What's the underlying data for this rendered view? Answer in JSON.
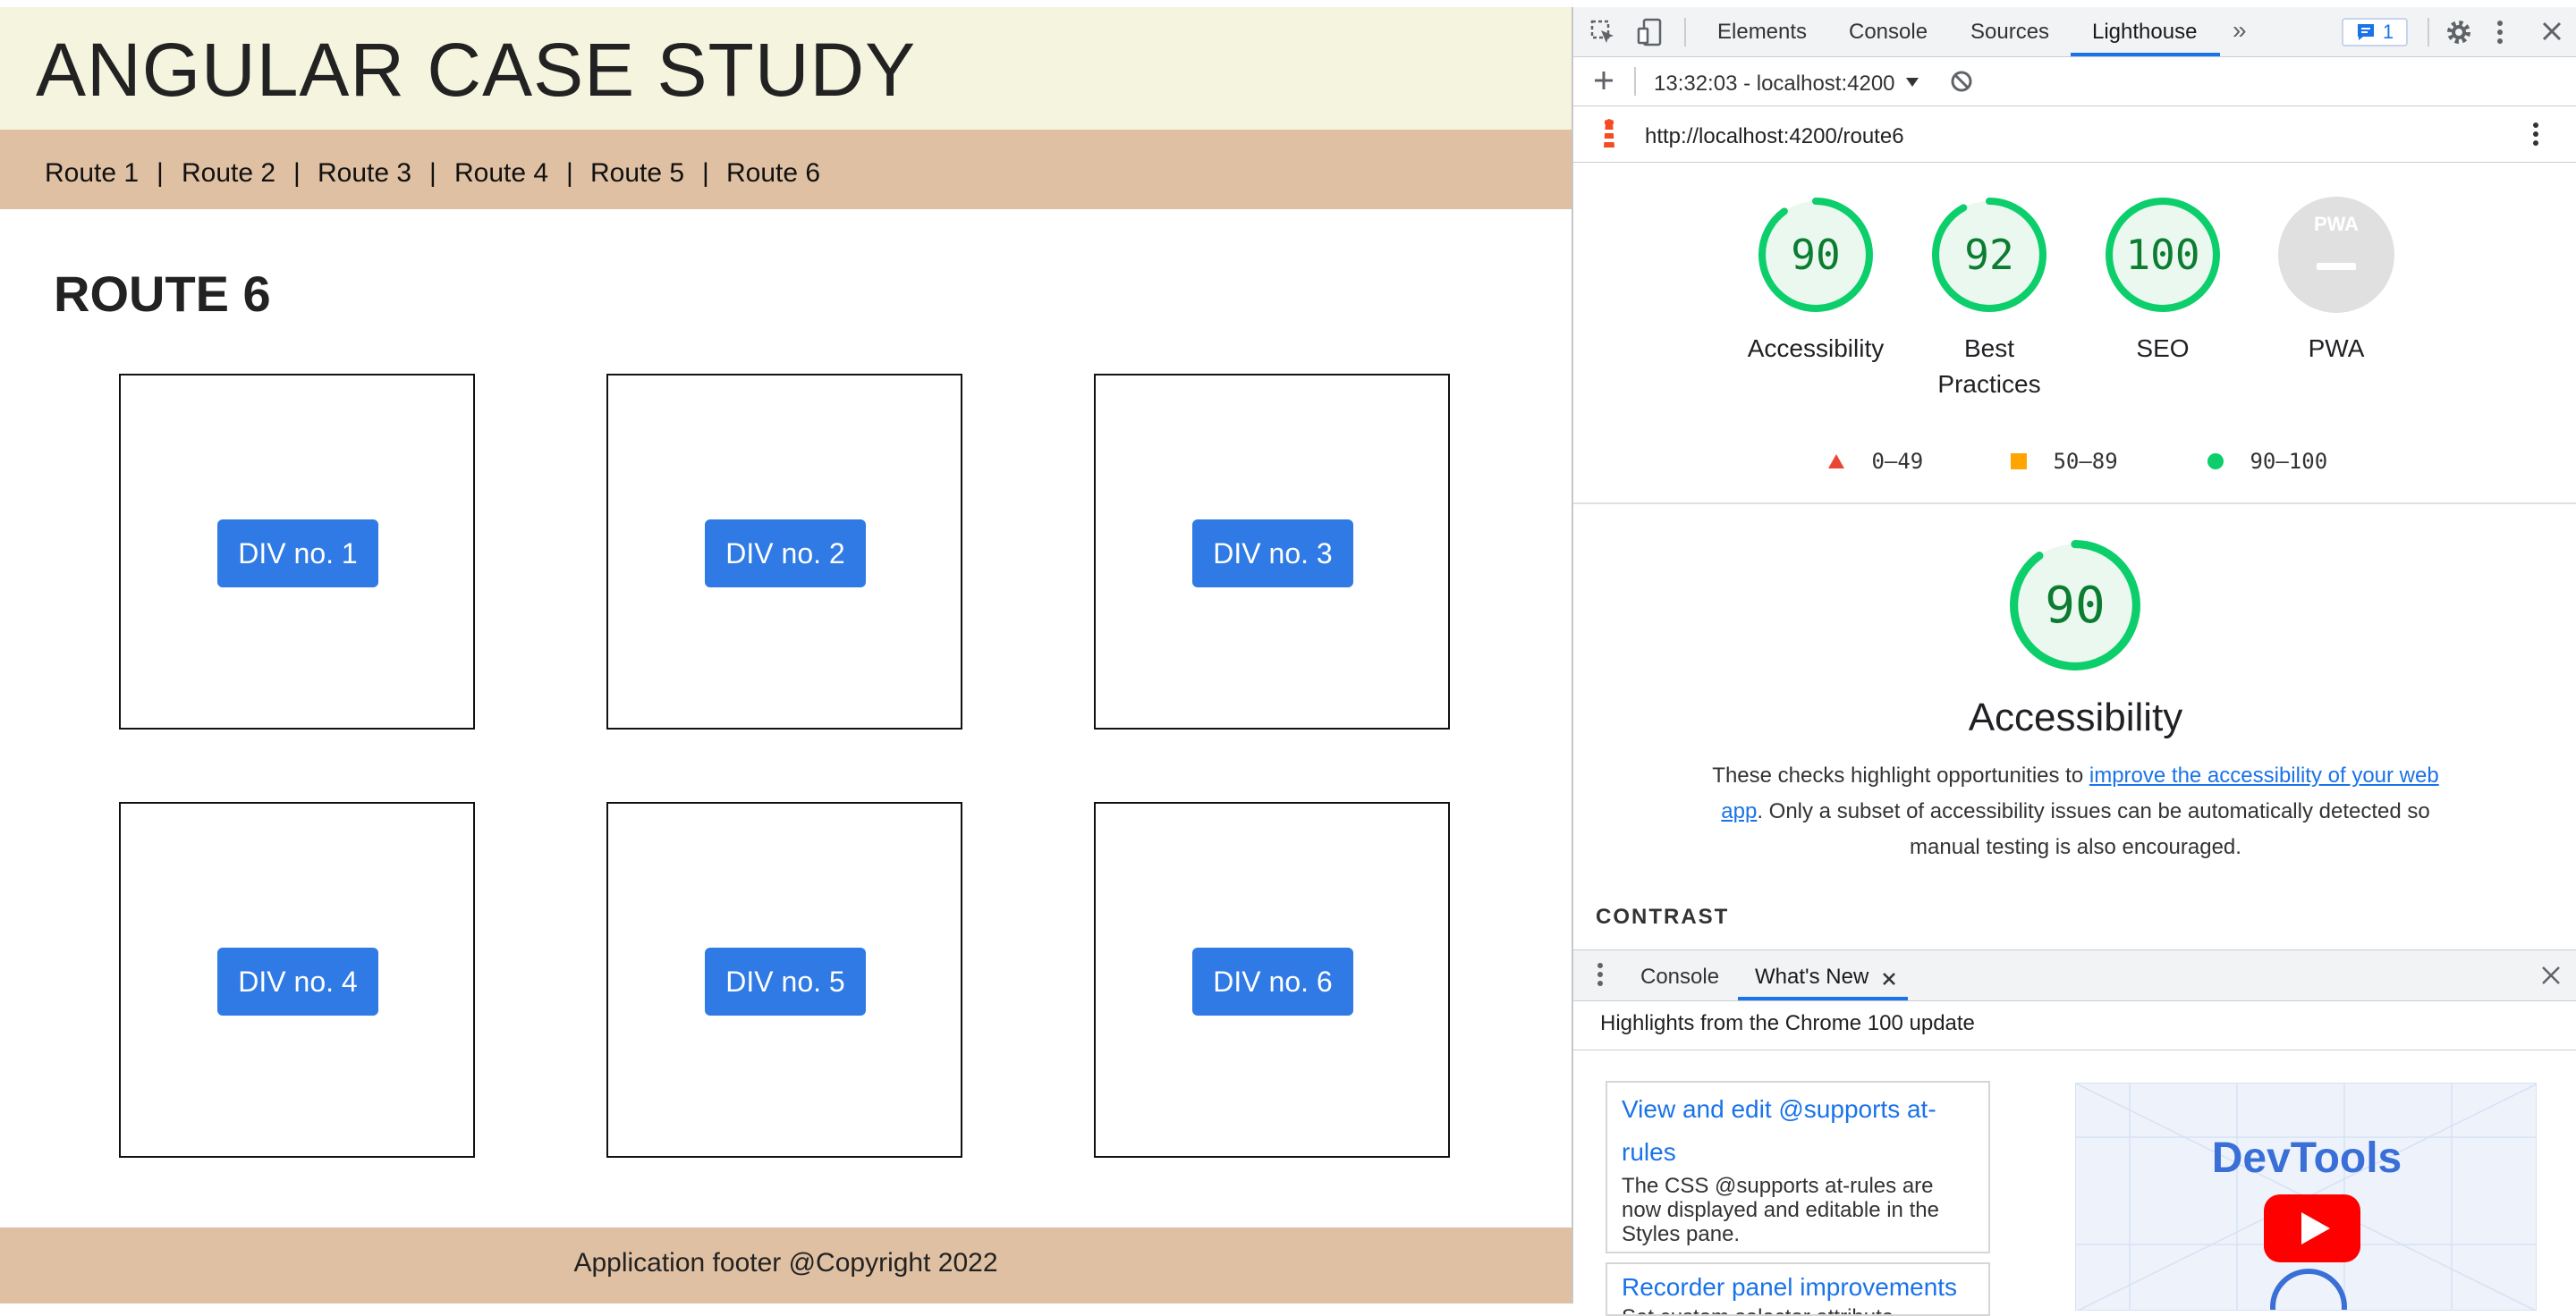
{
  "app": {
    "title": "ANGULAR CASE STUDY",
    "nav": [
      "Route 1",
      "Route 2",
      "Route 3",
      "Route 4",
      "Route 5",
      "Route 6"
    ],
    "nav_separator": "|",
    "route_heading": "ROUTE 6",
    "boxes": [
      "DIV no. 1",
      "DIV no. 2",
      "DIV no. 3",
      "DIV no. 4",
      "DIV no. 5",
      "DIV no. 6"
    ],
    "footer": "Application footer @Copyright 2022"
  },
  "devtools": {
    "tabs": [
      "Elements",
      "Console",
      "Sources",
      "Lighthouse"
    ],
    "active_tab": "Lighthouse",
    "more_tabs_icon": "»",
    "issues_count": "1",
    "run_label": "13:32:03 - localhost:4200",
    "url": "http://localhost:4200/route6",
    "scores": [
      {
        "label": "Accessibility",
        "value": "90",
        "fraction": 0.9
      },
      {
        "label": "Best\nPractices",
        "value": "92",
        "fraction": 0.92
      },
      {
        "label": "SEO",
        "value": "100",
        "fraction": 1.0
      },
      {
        "label": "PWA",
        "value": "PWA",
        "fraction": 0
      }
    ],
    "legend": [
      "0–49",
      "50–89",
      "90–100"
    ],
    "category": {
      "score": "90",
      "fraction": 0.9,
      "title": "Accessibility",
      "desc_before": "These checks highlight opportunities to ",
      "desc_link": "improve the accessibility of your web app",
      "desc_after": ". Only a subset of accessibility issues can be automatically detected so manual testing is also encouraged."
    },
    "section_heading": "CONTRAST",
    "drawer": {
      "tabs": [
        "Console",
        "What's New"
      ],
      "active_tab": "What's New",
      "highlights": "Highlights from the Chrome 100 update",
      "cards": [
        {
          "title": "View and edit @supports at-rules",
          "body": "The CSS @supports at-rules are now displayed and editable in the Styles pane."
        },
        {
          "title": "Recorder panel improvements",
          "body": "Set custom selector attribute..."
        }
      ],
      "promo_title": "DevTools"
    },
    "colors": {
      "pass": "#0c7c31",
      "pass_ring": "#0cce6b",
      "fail": "#eb4534",
      "average": "#ffa400",
      "link": "#1a73e8"
    }
  }
}
